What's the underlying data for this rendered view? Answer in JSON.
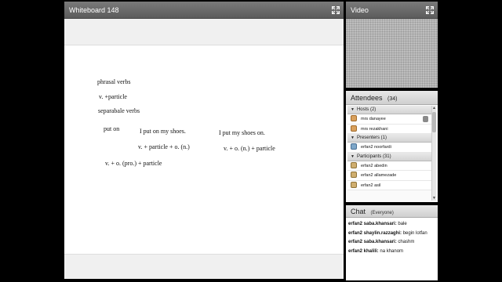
{
  "whiteboard": {
    "title": "Whiteboard 148",
    "lines": [
      "phrasal verbs",
      "v.  +particle",
      "separabale verbs",
      "put on",
      "I put on my shoes.",
      "v. + particle + o. (n.)",
      "v. + o. (pro.) + particle",
      "I put my shoes on.",
      "v. + o. (n.) + particle"
    ]
  },
  "video": {
    "title": "Video"
  },
  "attendees": {
    "title": "Attendees",
    "count": "(34)",
    "groups": {
      "hosts": {
        "label": "Hosts (2)",
        "members": [
          "mrs danayee",
          "mrs rezakhani"
        ]
      },
      "presenters": {
        "label": "Presenters (1)",
        "members": [
          "erfan2 noorfardi"
        ]
      },
      "participants": {
        "label": "Participants (31)",
        "members": [
          "erfan2 abedin",
          "erfan2 allamezade",
          "erfan2 asil"
        ]
      }
    }
  },
  "chat": {
    "title": "Chat",
    "scope": "(Everyone)",
    "messages": [
      {
        "who": "erfan2 saba.khansari:",
        "text": "bale"
      },
      {
        "who": "erfan2 shaylin.razzaghi:",
        "text": "begin lotfan"
      },
      {
        "who": "erfan2 saba.khansari:",
        "text": "chashm"
      },
      {
        "who": "erfan2 khalili:",
        "text": "na khanom"
      }
    ]
  },
  "icons": {
    "fullscreen": "fullscreen-icon",
    "host": "host-user-icon",
    "presenter": "presenter-user-icon",
    "participant": "participant-user-icon",
    "microphone": "microphone-icon"
  },
  "colors": {
    "header": "#5c5c5c",
    "video_bg": "#bdbdbd"
  }
}
